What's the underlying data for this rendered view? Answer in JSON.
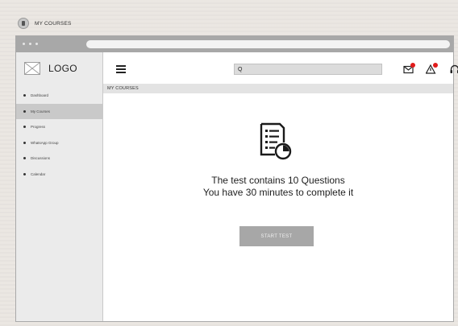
{
  "caption": {
    "text": "MY COURSES"
  },
  "sidebar": {
    "logo": "LOGO",
    "items": [
      {
        "label": "Dashboard",
        "active": false
      },
      {
        "label": "My Courses",
        "active": true
      },
      {
        "label": "Progress",
        "active": false
      },
      {
        "label": "WhatsApp Group",
        "active": false
      },
      {
        "label": "Discussions",
        "active": false
      },
      {
        "label": "Calendar",
        "active": false
      }
    ]
  },
  "topbar": {
    "search_icon": "Q",
    "search_value": ""
  },
  "breadcrumb": {
    "title": "MY COURSES"
  },
  "main": {
    "line1": "The test contains 10 Questions",
    "line2": "You have 30 minutes to complete it",
    "start_label": "START TEST"
  },
  "colors": {
    "notification_dot": "#e11b1b",
    "button_bg": "#a7a7a7",
    "sidebar_active": "#c9c9c9"
  },
  "icons": [
    "hamburger-icon",
    "search-icon",
    "mail-icon",
    "alert-icon",
    "headset-icon",
    "test-document-icon",
    "logo-placeholder-icon"
  ]
}
